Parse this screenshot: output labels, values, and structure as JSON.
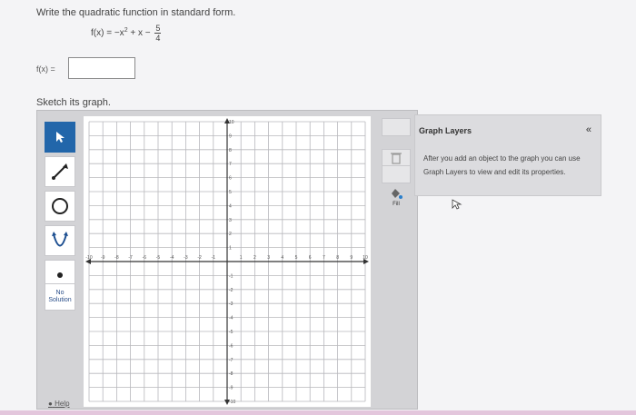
{
  "question": {
    "prompt": "Write the quadratic function in standard form.",
    "function_lhs": "f(x) = −x",
    "exponent": "2",
    "function_rest": " + x −",
    "frac_num": "5",
    "frac_den": "4",
    "answer_label": "f(x) =",
    "answer_value": "",
    "sketch_prompt": "Sketch its graph."
  },
  "toolbar": {
    "pointer_icon": "arrow-pointer-icon",
    "line_icon": "line-segment-icon",
    "circle_icon": "circle-icon",
    "parabola_icon": "parabola-icon",
    "point_icon": "point-icon",
    "no_solution_line1": "No",
    "no_solution_line2": "Solution",
    "help_label": "Help"
  },
  "grid": {
    "x_min": -10,
    "x_max": 10,
    "y_min": -10,
    "y_max": 10,
    "tick_labels_x": [
      "-10",
      "-9",
      "-8",
      "-7",
      "-6",
      "-5",
      "-4",
      "-3",
      "-2",
      "-1",
      "1",
      "2",
      "3",
      "4",
      "5",
      "6",
      "7",
      "8",
      "9",
      "10"
    ],
    "tick_labels_y": [
      "10",
      "9",
      "8",
      "7",
      "6",
      "5",
      "4",
      "3",
      "2",
      "1",
      "-1",
      "-2",
      "-3",
      "-4",
      "-5",
      "-6",
      "-7",
      "-8",
      "-9",
      "-10"
    ],
    "axis_color": "#333333",
    "grid_color": "#b8b8bc"
  },
  "side_tools": {
    "trash_icon": "trash-icon",
    "fill_icon": "fill-icon",
    "fill_label": "Fill"
  },
  "layers": {
    "title": "Graph Layers",
    "collapse_icon": "double-chevron-left-icon",
    "collapse_label": "«",
    "body": "After you add an object to the graph you can use Graph Layers to view and edit its properties."
  }
}
